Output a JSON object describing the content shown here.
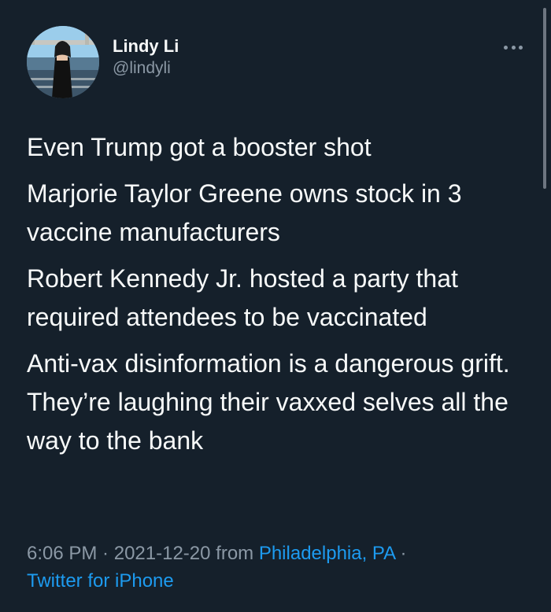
{
  "author": {
    "display_name": "Lindy Li",
    "handle": "@lindyli"
  },
  "icons": {
    "more": "more-horizontal-icon"
  },
  "tweet": {
    "paragraphs": [
      "Even Trump got a booster shot",
      "Marjorie Taylor Greene owns stock in 3 vaccine manufacturers",
      "Robert Kennedy Jr. hosted a party that required attendees to be vaccinated",
      "Anti-vax disinformation is a dangerous grift. They’re laughing their vaxxed selves all the way to the bank"
    ]
  },
  "meta": {
    "time": "6:06 PM",
    "separator": " · ",
    "date": "2021-12-20",
    "from_label": " from ",
    "location": "Philadelphia, PA",
    "source": "Twitter for iPhone"
  },
  "colors": {
    "background": "#15202b",
    "text_primary": "#f7f9f9",
    "text_secondary": "#8b98a5",
    "link": "#1d9bf0"
  }
}
